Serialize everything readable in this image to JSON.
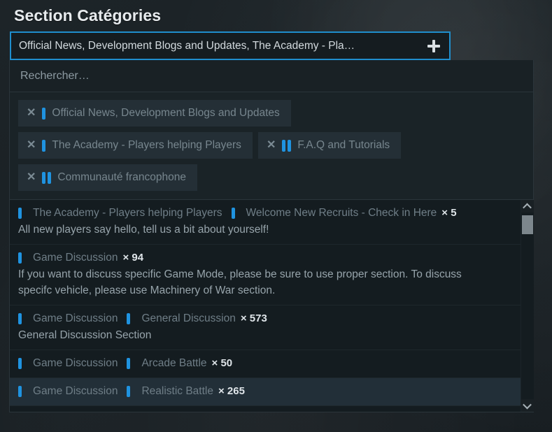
{
  "page": {
    "title": "Section Catégories"
  },
  "combo": {
    "value": "Official News, Development Blogs and Updates, The Academy - Pla…",
    "add_icon": "plus-icon"
  },
  "search": {
    "placeholder": "Rechercher…",
    "value": ""
  },
  "colors": {
    "accent_border": "#1f8ecd",
    "bar_blue": "#1f93e0",
    "panel_bg": "#1a2327",
    "list_bg": "#141c20",
    "chip_bg": "#242f36",
    "highlight_bg": "#222f38"
  },
  "selected_chips": [
    {
      "label": "Official News, Development Blogs and Updates",
      "depth": 1,
      "remove_icon": "close-icon"
    },
    {
      "label": "The Academy - Players helping Players",
      "depth": 1,
      "remove_icon": "close-icon"
    },
    {
      "label": "F.A.Q and Tutorials",
      "depth": 2,
      "remove_icon": "close-icon"
    },
    {
      "label": "Communauté francophone",
      "depth": 2,
      "remove_icon": "close-icon"
    }
  ],
  "options": [
    {
      "crumbs": [
        "The Academy - Players helping Players",
        "Welcome New Recruits - Check in Here"
      ],
      "count": "× 5",
      "description": "All new players say hello, tell us a bit about yourself!",
      "highlighted": false
    },
    {
      "crumbs": [
        "Game Discussion"
      ],
      "count": "× 94",
      "description": "If you want to discuss specific Game Mode, please be sure to use proper section. To discuss specifc vehicle, please use Machinery of War section.",
      "highlighted": false
    },
    {
      "crumbs": [
        "Game Discussion",
        "General Discussion"
      ],
      "count": "× 573",
      "description": "General Discussion Section",
      "highlighted": false
    },
    {
      "crumbs": [
        "Game Discussion",
        "Arcade Battle"
      ],
      "count": "× 50",
      "description": "",
      "highlighted": false
    },
    {
      "crumbs": [
        "Game Discussion",
        "Realistic Battle"
      ],
      "count": "× 265",
      "description": "",
      "highlighted": true
    }
  ],
  "scrollbar": {
    "up_icon": "chevron-up-icon",
    "down_icon": "chevron-down-icon"
  }
}
